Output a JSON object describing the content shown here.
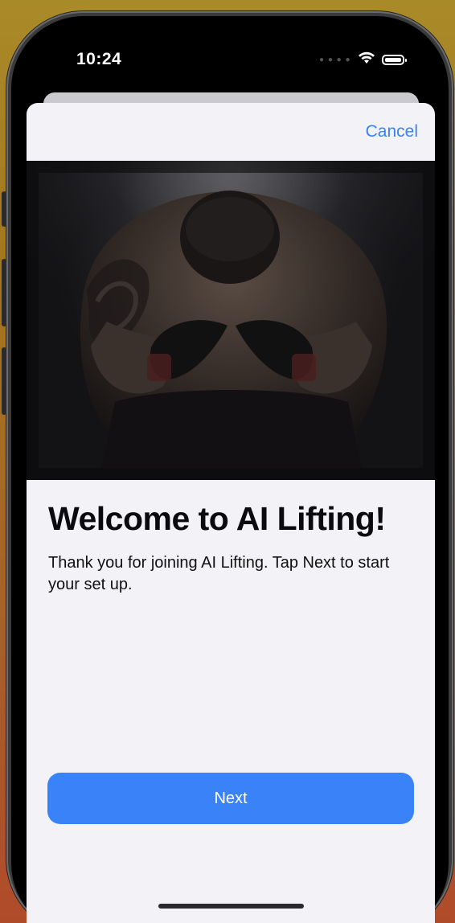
{
  "status_bar": {
    "time": "10:24",
    "signal_icon": "cellular-dots-icon",
    "wifi_icon": "wifi-icon",
    "battery_icon": "battery-icon"
  },
  "sheet": {
    "cancel_label": "Cancel",
    "hero_image": "boxer-with-head-down-photo",
    "title": "Welcome to AI Lifting!",
    "subtitle": "Thank you for joining AI Lifting. Tap Next to start your set up.",
    "next_label": "Next"
  },
  "colors": {
    "accent": "#3a82f7",
    "sheet_background": "#f2f2f7",
    "title_text": "#0b0b0d"
  }
}
